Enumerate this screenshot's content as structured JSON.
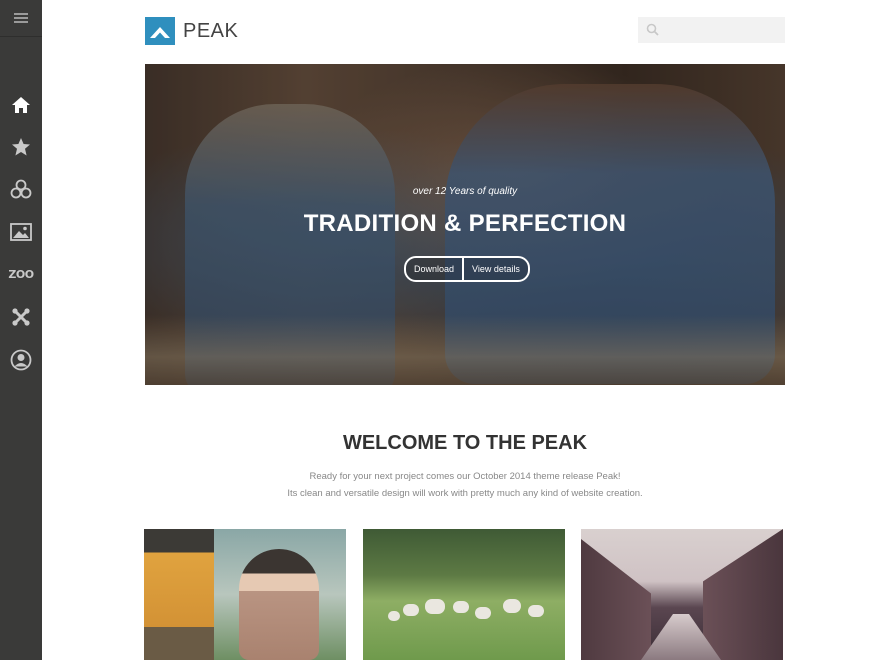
{
  "sidebar": {
    "items": [
      {
        "icon": "menu-icon"
      },
      {
        "icon": "home-icon"
      },
      {
        "icon": "star-icon"
      },
      {
        "icon": "circles-icon"
      },
      {
        "icon": "image-icon"
      },
      {
        "icon": "zoo-icon",
        "label": "ZOO"
      },
      {
        "icon": "joomla-icon"
      },
      {
        "icon": "user-icon"
      }
    ]
  },
  "header": {
    "logo_text": "PEAK",
    "search_placeholder": ""
  },
  "hero": {
    "caption": "over 12 Years of quality",
    "title": "TRADITION & PERFECTION",
    "buttons": [
      "Download",
      "View details"
    ]
  },
  "welcome": {
    "title": "WELCOME TO THE PEAK",
    "line1": "Ready for your next project comes our October 2014 theme release Peak!",
    "line2": "Its clean and versatile design will work with pretty much any kind of website creation."
  },
  "colors": {
    "sidebar": "#3a3a39",
    "accent": "#2f8fbe"
  }
}
